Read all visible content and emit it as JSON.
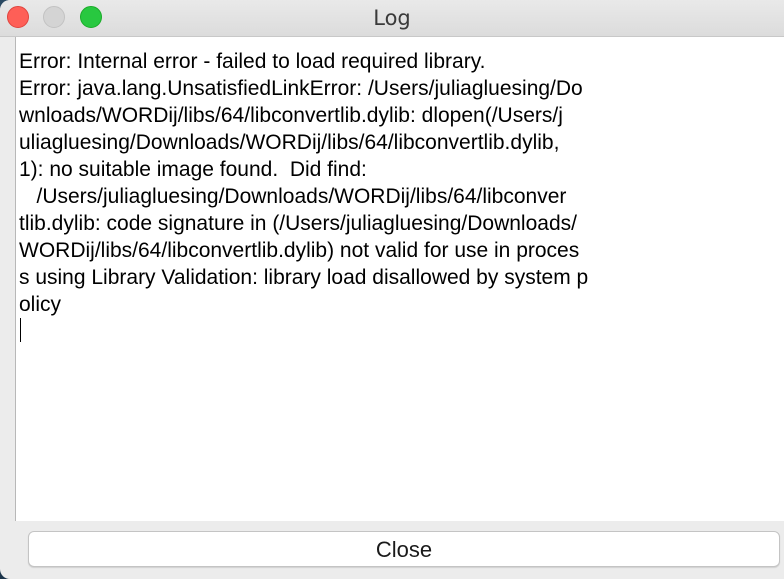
{
  "window": {
    "title": "Log",
    "controls": {
      "close_color": "#fe5f57",
      "minimize_color": "#d4d4d4",
      "zoom_color": "#28c840"
    }
  },
  "log": {
    "lines": [
      "Error: Internal error - failed to load required library.",
      "Error: java.lang.UnsatisfiedLinkError: /Users/juliagluesing/Do",
      "wnloads/WORDij/libs/64/libconvertlib.dylib: dlopen(/Users/j",
      "uliagluesing/Downloads/WORDij/libs/64/libconvertlib.dylib,",
      "1): no suitable image found.  Did find:",
      "   /Users/juliagluesing/Downloads/WORDij/libs/64/libconver",
      "tlib.dylib: code signature in (/Users/juliagluesing/Downloads/",
      "WORDij/libs/64/libconvertlib.dylib) not valid for use in proces",
      "s using Library Validation: library load disallowed by system p",
      "olicy"
    ]
  },
  "footer": {
    "close_label": "Close"
  }
}
